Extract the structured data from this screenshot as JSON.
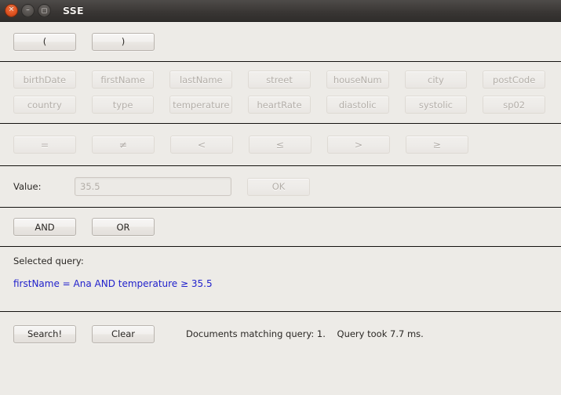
{
  "window": {
    "title": "SSE",
    "buttons": {
      "close": {
        "name": "close-icon",
        "glyph": "✕"
      },
      "minimize": {
        "name": "minimize-icon",
        "glyph": "–"
      },
      "maximize": {
        "name": "maximize-icon",
        "glyph": "□"
      }
    }
  },
  "paren_row": {
    "open_label": "(",
    "close_label": ")"
  },
  "fields": {
    "row1": [
      "birthDate",
      "firstName",
      "lastName",
      "street",
      "houseNum",
      "city",
      "postCode"
    ],
    "row2": [
      "country",
      "type",
      "temperature",
      "heartRate",
      "diastolic",
      "systolic",
      "sp02"
    ]
  },
  "operators": [
    "=",
    "≠",
    "<",
    "≤",
    ">",
    "≥"
  ],
  "value_row": {
    "label": "Value:",
    "input_value": "35.5",
    "input_placeholder": "35.5",
    "ok_label": "OK"
  },
  "logic_row": {
    "and_label": "AND",
    "or_label": "OR"
  },
  "query": {
    "heading": "Selected query:",
    "text": "firstName = Ana AND temperature ≥ 35.5",
    "color": "#2222cc"
  },
  "bottom": {
    "search_label": "Search!",
    "clear_label": "Clear",
    "status": "Documents matching query: 1.    Query took 7.7 ms."
  }
}
